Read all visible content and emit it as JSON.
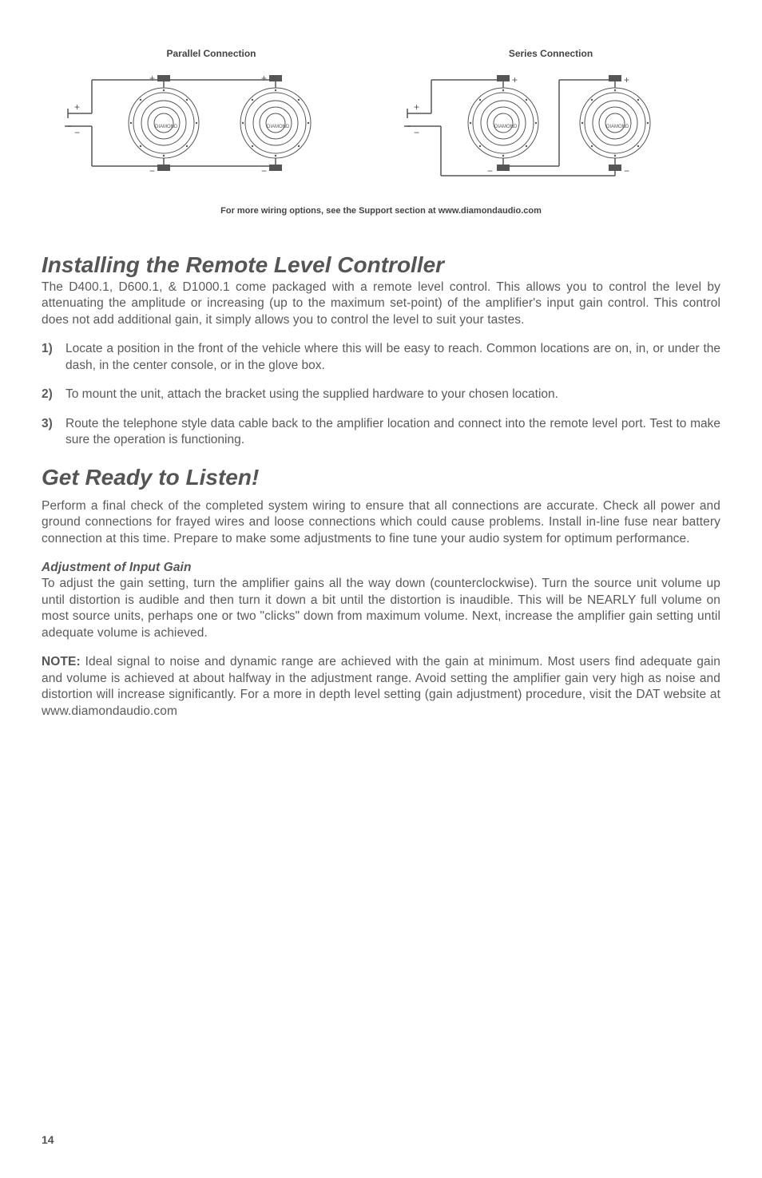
{
  "diagrams": {
    "parallel_label": "Parallel Connection",
    "series_label": "Series Connection"
  },
  "wiring_note": "For more wiring options, see the Support section at www.diamondaudio.com",
  "section1": {
    "heading": "Installing the Remote Level Controller",
    "intro": "The D400.1, D600.1, & D1000.1 come packaged with a remote level control. This allows you to control the level by attenuating the amplitude or increasing (up to the maximum set-point) of the amplifier's input gain control. This control does not add additional gain, it simply allows you to control the level to suit your tastes.",
    "steps": [
      {
        "num": "1)",
        "text": "Locate a position in the front of the vehicle where this will be easy to reach. Common locations are on, in, or under the dash, in the center console, or in the glove box."
      },
      {
        "num": "2)",
        "text": "To mount the unit, attach the bracket using the supplied hardware to your chosen location."
      },
      {
        "num": "3)",
        "text": "Route the telephone style data cable back to the amplifier location and connect into the remote level port. Test to make sure the operation is functioning."
      }
    ]
  },
  "section2": {
    "heading": "Get Ready to Listen!",
    "p1": "Perform a final check of the completed system wiring to ensure that all connections are accurate. Check all power and ground connections for frayed wires and loose connections which could cause problems. Install in-line fuse near battery connection at this time. Prepare to make some adjustments to fine tune your audio system for optimum performance.",
    "subhead": "Adjustment of Input Gain",
    "p2": "To adjust the gain setting, turn the amplifier gains all the way down (counterclockwise). Turn the source unit volume up until distortion is audible and then turn it down a bit until the distortion is inaudible. This will be NEARLY full volume on most source units, perhaps one or two \"clicks\" down from maximum volume. Next, increase the amplifier gain setting until adequate volume is achieved.",
    "note_label": "NOTE:",
    "note_text": "  Ideal signal to noise and dynamic range are achieved with the gain at minimum. Most users find adequate gain and volume is achieved at about halfway in the adjustment range. Avoid setting the amplifier gain very high as noise and distortion will increase significantly. For a more in depth level setting (gain adjustment) procedure, visit the DAT website at www.diamondaudio.com"
  },
  "page_number": "14"
}
